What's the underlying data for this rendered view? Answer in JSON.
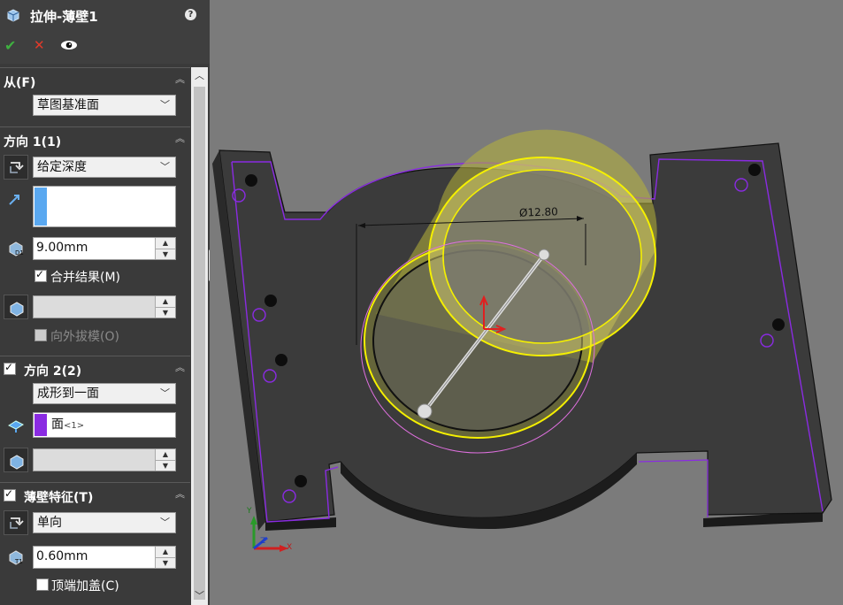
{
  "panel": {
    "feature_title": "拉伸-薄壁1",
    "help_glyph": "?",
    "from": {
      "title": "从(F)",
      "select_value": "草图基准面"
    },
    "direction1": {
      "title": "方向 1(1)",
      "end_condition": "给定深度",
      "depth": "9.00mm",
      "merge_result_label": "合并结果(M)",
      "merge_result_checked": true,
      "draft_outward_label": "向外拔模(O)",
      "draft_outward_checked": false
    },
    "direction2": {
      "title": "方向 2(2)",
      "checked": true,
      "end_condition": "成形到一面",
      "face_item": "面",
      "face_item_suffix": "<1>"
    },
    "thin_feature": {
      "title": "薄壁特征(T)",
      "checked": true,
      "type": "单向",
      "thickness": "0.60mm",
      "cap_ends_label": "顶端加盖(C)",
      "cap_ends_checked": false
    }
  },
  "viewport": {
    "dimension_label": "Ø12.80",
    "triad": {
      "x": "X",
      "y": "Y",
      "z": "Z"
    }
  },
  "colors": {
    "accent_blue": "#5aa8f0",
    "face_purple": "#8a2be2",
    "thin_yellow": "#f5f000",
    "ok_green": "#3fb040",
    "cancel_red": "#e23a2a"
  }
}
